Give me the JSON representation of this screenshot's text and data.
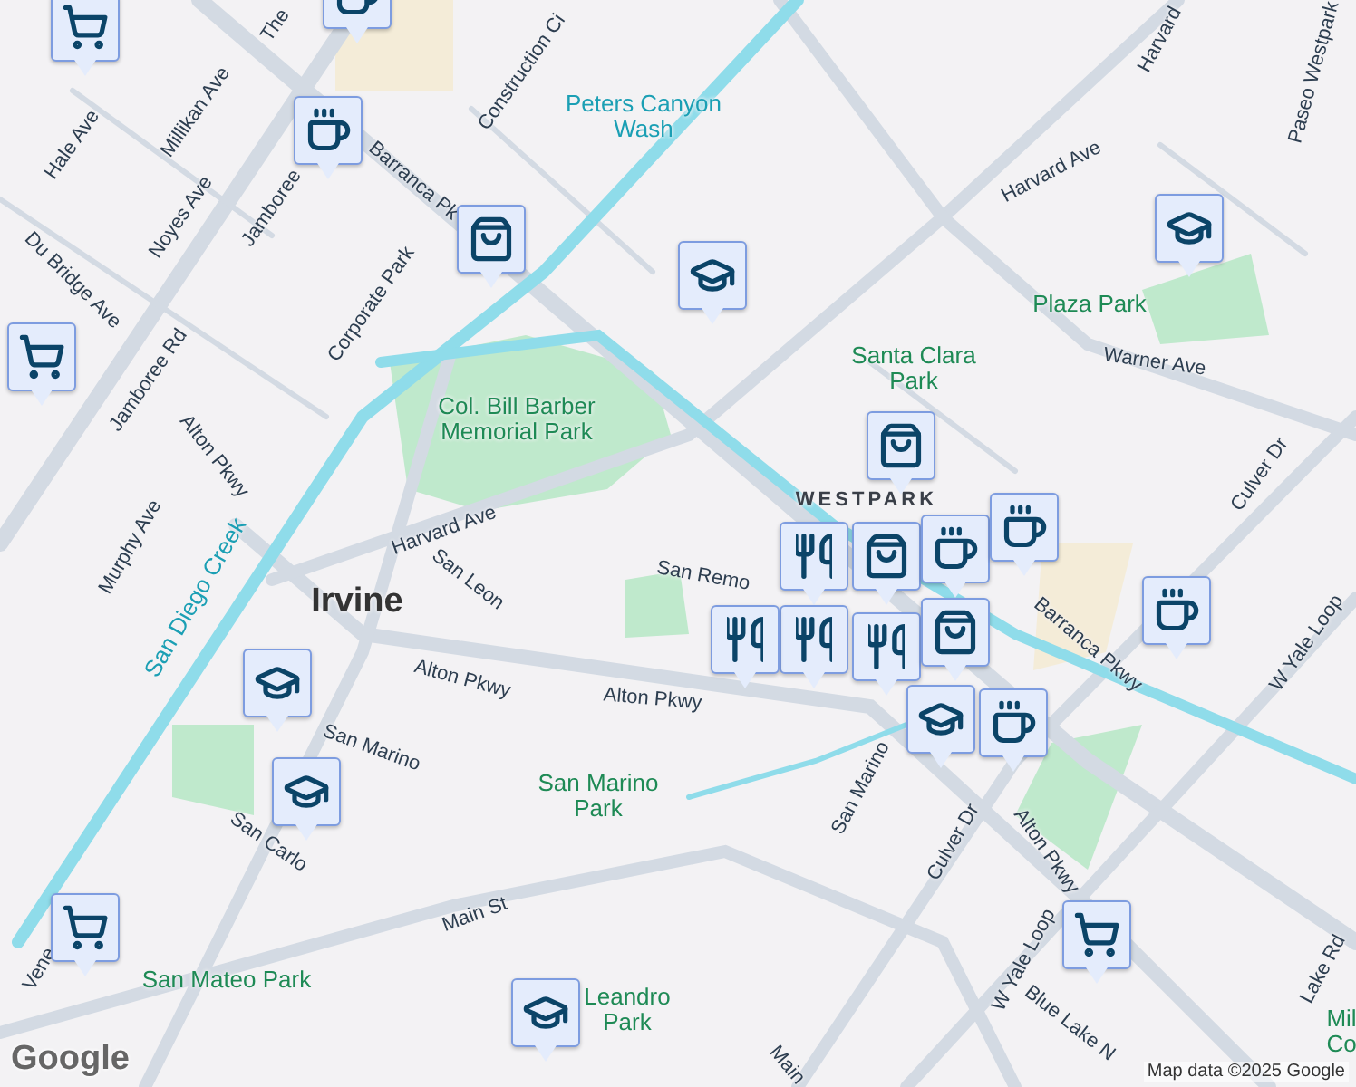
{
  "map": {
    "labels": [
      {
        "kind": "street",
        "text": "The"
      },
      {
        "kind": "street",
        "text": "Hale Ave"
      },
      {
        "kind": "street",
        "text": "Millikan Ave"
      },
      {
        "kind": "street",
        "text": "Noyes Ave"
      },
      {
        "kind": "street",
        "text": "Du Bridge Ave"
      },
      {
        "kind": "street",
        "text": "Jamboree"
      },
      {
        "kind": "street",
        "text": "Jamboree Rd"
      },
      {
        "kind": "street",
        "text": "Barranca Pk"
      },
      {
        "kind": "street",
        "text": "Corporate Park"
      },
      {
        "kind": "street",
        "text": "Construction Ci"
      },
      {
        "kind": "water",
        "text": "Peters Canyon Wash"
      },
      {
        "kind": "park",
        "text": "Col. Bill Barber Memorial Park"
      },
      {
        "kind": "street",
        "text": "Alton Pkwy"
      },
      {
        "kind": "street",
        "text": "Murphy Ave"
      },
      {
        "kind": "street",
        "text": "Harvard Ave"
      },
      {
        "kind": "water",
        "text": "San Diego Creek"
      },
      {
        "kind": "city",
        "text": "Irvine"
      },
      {
        "kind": "street",
        "text": "San Leon"
      },
      {
        "kind": "street",
        "text": "Alton Pkwy"
      },
      {
        "kind": "street",
        "text": "Alton Pkwy"
      },
      {
        "kind": "street",
        "text": "San Remo"
      },
      {
        "kind": "street",
        "text": "Harvard"
      },
      {
        "kind": "street",
        "text": "Harvard Ave"
      },
      {
        "kind": "street",
        "text": "Paseo Westpark"
      },
      {
        "kind": "park",
        "text": "Plaza Park"
      },
      {
        "kind": "street",
        "text": "Warner Ave"
      },
      {
        "kind": "park",
        "text": "Santa Clara Park"
      },
      {
        "kind": "district",
        "text": "WESTPARK"
      },
      {
        "kind": "street",
        "text": "Culver Dr"
      },
      {
        "kind": "street",
        "text": "Barranca Pkwy"
      },
      {
        "kind": "street",
        "text": "W Yale Loop"
      },
      {
        "kind": "street",
        "text": "San Marino"
      },
      {
        "kind": "park",
        "text": "San Marino Park"
      },
      {
        "kind": "street",
        "text": "San Marino"
      },
      {
        "kind": "street",
        "text": "Culver Dr"
      },
      {
        "kind": "street",
        "text": "Alton Pkwy"
      },
      {
        "kind": "street",
        "text": "San Carlo"
      },
      {
        "kind": "street",
        "text": "Main St"
      },
      {
        "kind": "street",
        "text": "Vene"
      },
      {
        "kind": "park",
        "text": "San Mateo Park"
      },
      {
        "kind": "park",
        "text": "Leandro Park"
      },
      {
        "kind": "street",
        "text": "W Yale Loop"
      },
      {
        "kind": "street",
        "text": "Blue Lake N"
      },
      {
        "kind": "street",
        "text": "Lake Rd"
      },
      {
        "kind": "park",
        "text": "Mil Co"
      },
      {
        "kind": "street",
        "text": "Main"
      }
    ],
    "markers": [
      {
        "kind": "grocery"
      },
      {
        "kind": "cafe"
      },
      {
        "kind": "cafe"
      },
      {
        "kind": "shopping"
      },
      {
        "kind": "grocery"
      },
      {
        "kind": "school"
      },
      {
        "kind": "school"
      },
      {
        "kind": "shopping"
      },
      {
        "kind": "restaurant"
      },
      {
        "kind": "shopping"
      },
      {
        "kind": "cafe"
      },
      {
        "kind": "cafe"
      },
      {
        "kind": "restaurant"
      },
      {
        "kind": "restaurant"
      },
      {
        "kind": "restaurant"
      },
      {
        "kind": "shopping"
      },
      {
        "kind": "cafe"
      },
      {
        "kind": "school"
      },
      {
        "kind": "cafe"
      },
      {
        "kind": "school"
      },
      {
        "kind": "school"
      },
      {
        "kind": "grocery"
      },
      {
        "kind": "school"
      },
      {
        "kind": "grocery"
      }
    ],
    "logo": "Google",
    "attribution": "Map data ©2025 Google"
  }
}
